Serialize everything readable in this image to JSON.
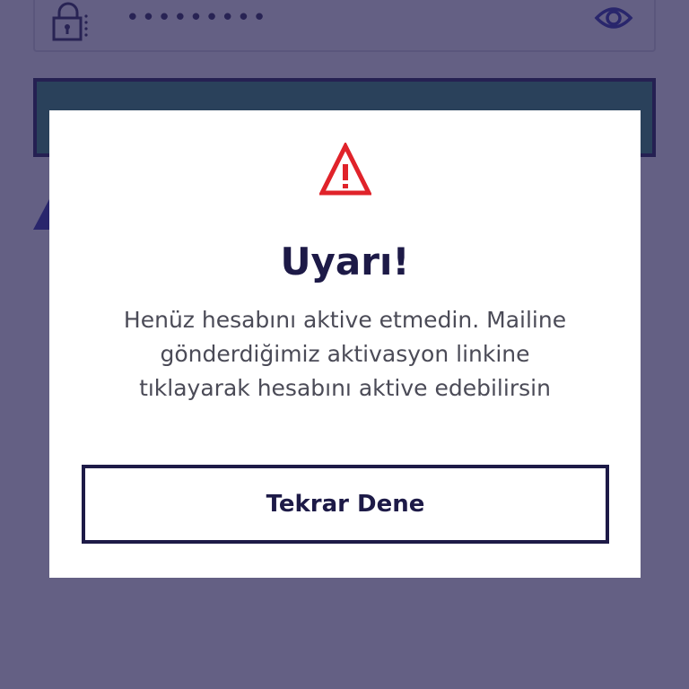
{
  "login_form": {
    "password_value": "•••••••••",
    "colors": {
      "button_green": "#2f8f6e",
      "button_border": "#1f1b4e"
    }
  },
  "icons": {
    "lock": "lock-icon",
    "eye": "eye-icon",
    "warning": "warning-icon"
  },
  "dialog": {
    "title": "Uyarı!",
    "message": "Henüz hesabını aktive etmedin. Mailine gönderdiğimiz aktivasyon linkine tıklayarak hesabını aktive edebilirsin",
    "retry_label": "Tekrar Dene",
    "colors": {
      "warning_red": "#e0232a",
      "text_dark": "#1d1a47",
      "overlay": "#282355"
    }
  }
}
